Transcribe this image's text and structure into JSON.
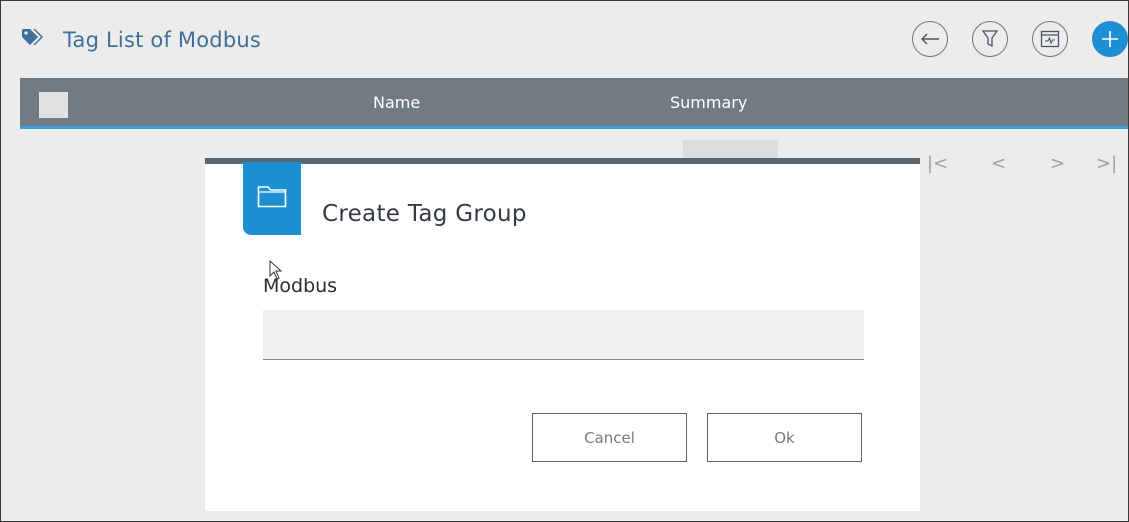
{
  "header": {
    "title": "Tag List of Modbus",
    "title_icon": "tags-icon",
    "toolbar": [
      {
        "name": "back-arrow-icon"
      },
      {
        "name": "filter-icon"
      },
      {
        "name": "monitor-icon"
      },
      {
        "name": "add-icon"
      }
    ]
  },
  "table": {
    "columns": [
      "Name",
      "Summary"
    ]
  },
  "pagination": {
    "first": "|<",
    "prev": "<",
    "next": ">",
    "last": ">|"
  },
  "dialog": {
    "title": "Create Tag Group",
    "icon": "folder-icon",
    "field_label": "Modbus",
    "field_value": "",
    "cancel_label": "Cancel",
    "ok_label": "Ok"
  },
  "colors": {
    "accent": "#1d8fd3",
    "header_bar": "#727a84",
    "title_text": "#3f6f9a"
  }
}
